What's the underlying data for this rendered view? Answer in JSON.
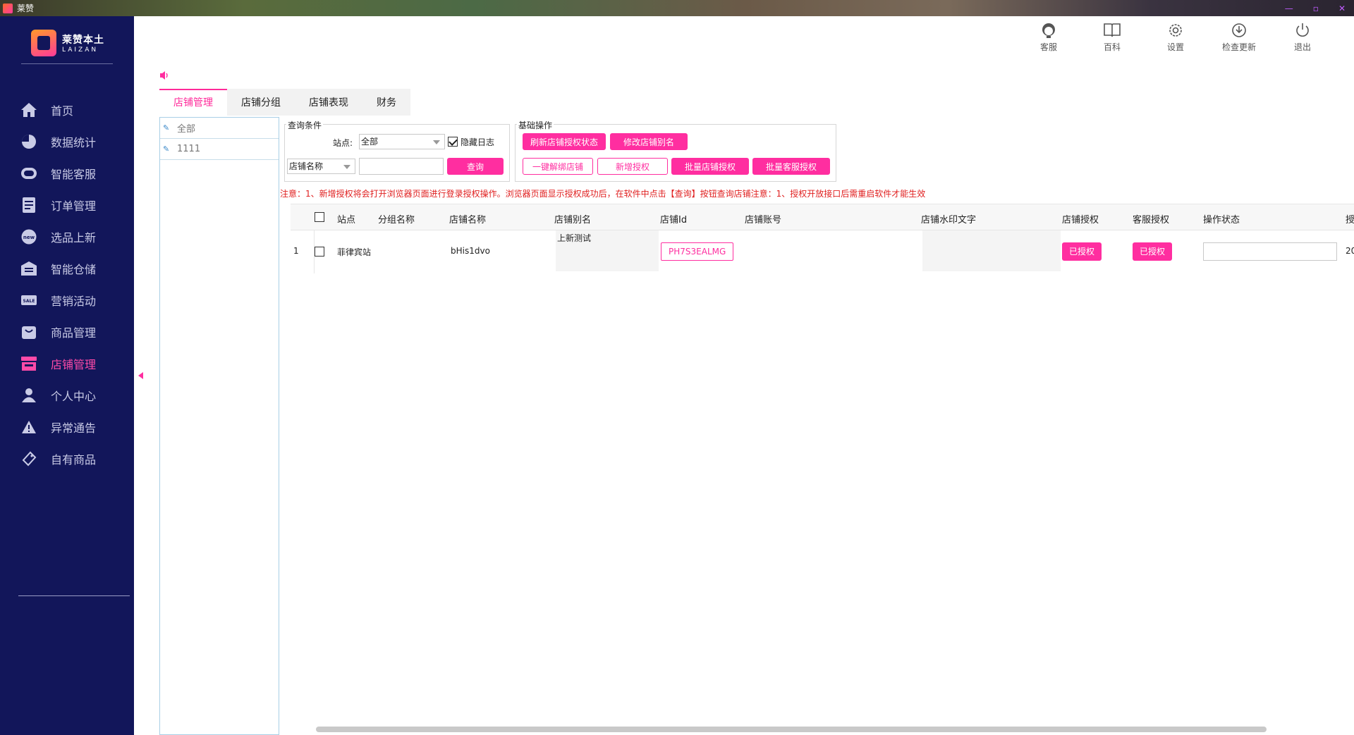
{
  "window": {
    "title": "莱赞",
    "controls": [
      "—",
      "▫",
      "✕"
    ]
  },
  "brand": {
    "name_cn": "莱赞本土",
    "name_en": "LAIZAN"
  },
  "sidebar": {
    "items": [
      {
        "label": "首页",
        "icon": "home-icon"
      },
      {
        "label": "数据统计",
        "icon": "pie-chart-icon"
      },
      {
        "label": "智能客服",
        "icon": "chat-icon"
      },
      {
        "label": "订单管理",
        "icon": "clipboard-icon"
      },
      {
        "label": "选品上新",
        "icon": "new-badge-icon"
      },
      {
        "label": "智能仓储",
        "icon": "warehouse-icon"
      },
      {
        "label": "营销活动",
        "icon": "sale-tag-icon"
      },
      {
        "label": "商品管理",
        "icon": "shopping-bag-icon"
      },
      {
        "label": "店铺管理",
        "icon": "store-icon",
        "active": true
      },
      {
        "label": "个人中心",
        "icon": "user-icon"
      },
      {
        "label": "异常通告",
        "icon": "warning-icon"
      },
      {
        "label": "自有商品",
        "icon": "tag-icon"
      }
    ]
  },
  "toolbar": {
    "items": [
      {
        "label": "客服",
        "icon": "support-agent-icon"
      },
      {
        "label": "百科",
        "icon": "book-icon"
      },
      {
        "label": "设置",
        "icon": "gear-icon"
      },
      {
        "label": "检查更新",
        "icon": "download-icon"
      },
      {
        "label": "退出",
        "icon": "power-icon"
      }
    ]
  },
  "tabs": [
    {
      "label": "店铺管理",
      "active": true
    },
    {
      "label": "店铺分组"
    },
    {
      "label": "店铺表现"
    },
    {
      "label": "财务"
    }
  ],
  "groups": [
    {
      "label": "全部"
    },
    {
      "label": "1111"
    }
  ],
  "query": {
    "legend": "查询条件",
    "site_label": "站点:",
    "site_value": "全部",
    "hide_log_label": "隐藏日志",
    "hide_log_checked": true,
    "field_select": "店铺名称",
    "search_value": "",
    "search_button": "查询"
  },
  "ops": {
    "legend": "基础操作",
    "refresh_auth": "刷新店铺授权状态",
    "rename_store": "修改店铺别名",
    "unbind": "一键解绑店铺",
    "new_auth": "新增授权",
    "batch_store_auth": "批量店铺授权",
    "batch_cs_auth": "批量客服授权"
  },
  "notice": "注意：1、新增授权将会打开浏览器页面进行登录授权操作。浏览器页面显示授权成功后，在软件中点击【查询】按钮查询店铺注意：1、授权开放接口后需重启软件才能生效",
  "table": {
    "columns": [
      "站点",
      "分组名称",
      "店铺名称",
      "店铺别名",
      "店铺Id",
      "店铺账号",
      "店铺水印文字",
      "店铺授权",
      "客服授权",
      "操作状态",
      "授"
    ],
    "rows": [
      {
        "index": "1",
        "site": "菲律宾站",
        "group": "",
        "store_name": "bHis1dvo",
        "alias": "上新测试",
        "store_id": "PH7S3EALMG",
        "account": "",
        "watermark": "",
        "store_auth": "已授权",
        "cs_auth": "已授权",
        "op_status": "",
        "auth_time_partial": "20"
      }
    ]
  },
  "colors": {
    "accent": "#ff2ea0",
    "sidebar_bg": "#12165a",
    "notice": "#e02020"
  }
}
